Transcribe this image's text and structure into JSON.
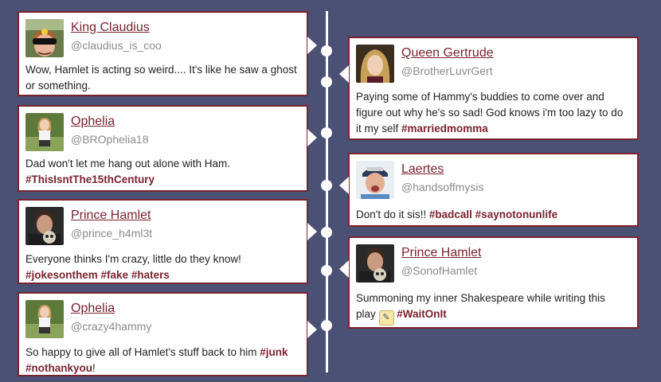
{
  "posts": [
    {
      "name": "King Claudius",
      "handle": "@claudius_is_coo",
      "text_parts": [
        "Wow, Hamlet is acting so weird.... It's like he saw a ghost or something."
      ],
      "tags": [],
      "avatar": "claudius-avatar"
    },
    {
      "name": "Queen Gertrude",
      "handle": "@BrotherLuvrGert",
      "text_parts": [
        "Paying some of Hammy's buddies to come over and figure out why he's so sad! God knows i'm too lazy to do it my self "
      ],
      "tags": [
        "#marriedmomma"
      ],
      "avatar": "gertrude-avatar"
    },
    {
      "name": "Ophelia",
      "handle": "@BROphelia18",
      "text_parts": [
        "Dad won't let me hang out alone with Ham. "
      ],
      "tags": [
        "#ThisIsntThe15thCentury"
      ],
      "avatar": "ophelia-avatar"
    },
    {
      "name": "Laertes",
      "handle": "@handsoffmysis",
      "text_parts": [
        "Don't do it sis!! "
      ],
      "tags": [
        "#badcall",
        "#saynotonunlife"
      ],
      "avatar": "laertes-avatar"
    },
    {
      "name": "Prince Hamlet",
      "handle": "@prince_h4ml3t",
      "text_parts": [
        "Everyone thinks I'm crazy, little do they know! "
      ],
      "tags": [
        "#jokesonthem",
        "#fake",
        "#haters"
      ],
      "avatar": "hamlet-avatar"
    },
    {
      "name": "Prince Hamlet",
      "handle": "@SonofHamlet",
      "text_parts": [
        "Summoning my inner Shakespeare while writing this play "
      ],
      "tags": [
        "#WaitOnIt"
      ],
      "avatar": "hamlet-avatar",
      "emoji": "pencil-emoji-icon"
    },
    {
      "name": "Ophelia",
      "handle": "@crazy4hammy",
      "text_parts": [
        "So happy to give all of Hamlet's stuff back to him ",
        " ",
        "!"
      ],
      "tags": [
        "#junk",
        "#nothankyou"
      ],
      "avatar": "ophelia-avatar"
    }
  ],
  "colors": {
    "background": "#4a5175",
    "accent": "#7a2330",
    "handle": "#8a8a8a"
  }
}
